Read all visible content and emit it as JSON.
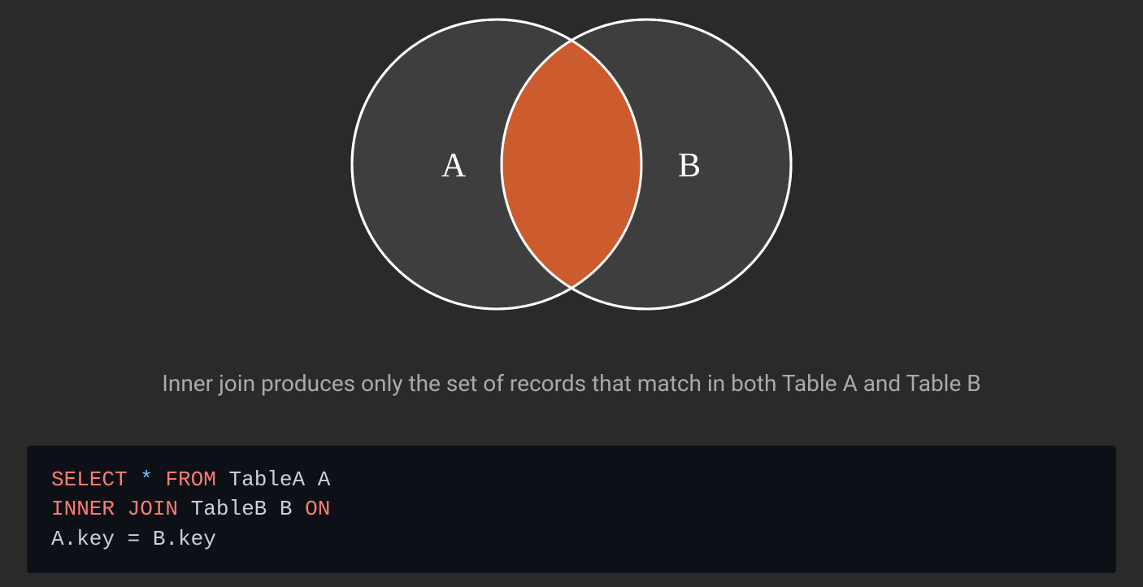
{
  "venn": {
    "labelA": "A",
    "labelB": "B"
  },
  "description": "Inner join produces only the set of records that match in both Table A and Table B",
  "sql": {
    "select": "SELECT",
    "star": "*",
    "from": "FROM",
    "tableA": "TableA A",
    "inner": "INNER",
    "join": "JOIN",
    "tableB": "TableB B",
    "on": "ON",
    "condition": "A.key = B.key"
  },
  "colors": {
    "circleFill": "#3e3e3e",
    "circleStroke": "#ffffff",
    "intersection": "#cc5b2e"
  }
}
